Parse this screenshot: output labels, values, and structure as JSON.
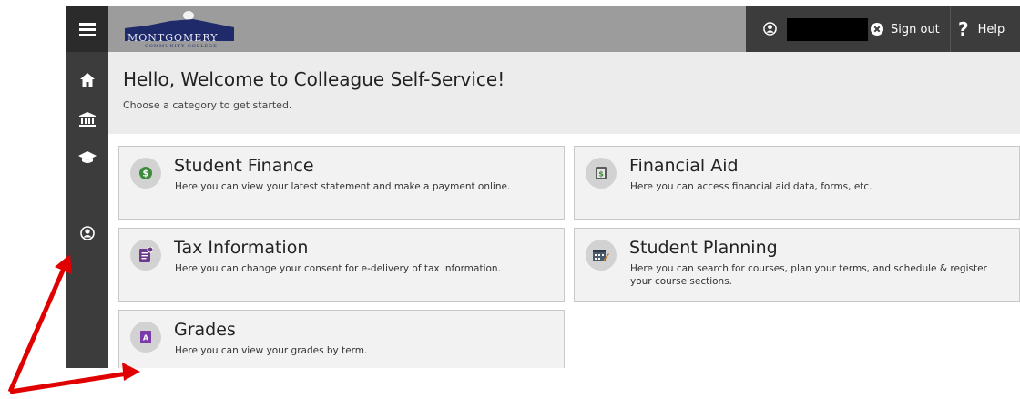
{
  "header": {
    "logo": {
      "text": "MONTGOMERY",
      "sub": "COMMUNITY COLLEGE"
    },
    "sign_out_label": "Sign out",
    "help_label": "Help",
    "help_glyph": "?"
  },
  "sidebar": {
    "items": [
      {
        "name": "menu-icon"
      },
      {
        "name": "home-icon"
      },
      {
        "name": "institution-icon"
      },
      {
        "name": "graduation-cap-icon"
      },
      {
        "name": "user-profile-icon"
      }
    ]
  },
  "welcome": {
    "title": "Hello, Welcome to Colleague Self-Service!",
    "subtitle": "Choose a category to get started."
  },
  "cards": [
    {
      "title": "Student Finance",
      "desc": "Here you can view your latest statement and make a payment online.",
      "icon": "dollar-icon",
      "icon_color": "#3c8a3c"
    },
    {
      "title": "Financial Aid",
      "desc": "Here you can access financial aid data, forms, etc.",
      "icon": "money-icon",
      "icon_color": "#5a5a5a"
    },
    {
      "title": "Tax Information",
      "desc": "Here you can change your consent for e-delivery of tax information.",
      "icon": "document-icon",
      "icon_color": "#6b3a8c"
    },
    {
      "title": "Student Planning",
      "desc": "Here you can search for courses, plan your terms, and schedule & register your course sections.",
      "icon": "calendar-icon",
      "icon_color": "#4a5a6a"
    },
    {
      "title": "Grades",
      "desc": "Here you can view your grades by term.",
      "icon": "grades-icon",
      "icon_color": "#7a3aa8"
    }
  ],
  "colors": {
    "sidebar": "#3c3c3c",
    "header": "#9c9c9c",
    "annotation_arrow": "#e00000"
  }
}
